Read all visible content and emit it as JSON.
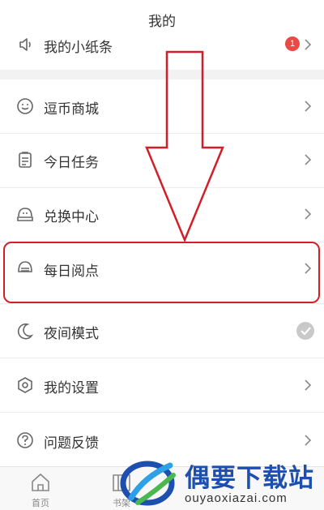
{
  "header": {
    "title": "我的"
  },
  "menu": {
    "note": {
      "label": "我的小纸条",
      "badge": "1"
    },
    "coin_mall": {
      "label": "逗币商城"
    },
    "daily_tasks": {
      "label": "今日任务"
    },
    "exchange": {
      "label": "兑换中心"
    },
    "daily_view": {
      "label": "每日阅点"
    },
    "night_mode": {
      "label": "夜间模式",
      "enabled": true
    },
    "settings": {
      "label": "我的设置"
    },
    "feedback": {
      "label": "问题反馈"
    }
  },
  "tabbar": {
    "home": {
      "label": "首页",
      "icon": "home-icon"
    },
    "shelf": {
      "label": "书架",
      "icon": "bookshelf-icon"
    }
  },
  "watermark": {
    "text": "偶要下载站",
    "url": "ouyaoxiazai.com"
  },
  "colors": {
    "highlight": "#d11f2a",
    "badge": "#e84a45",
    "watermark_blue": "#1d4fae"
  }
}
